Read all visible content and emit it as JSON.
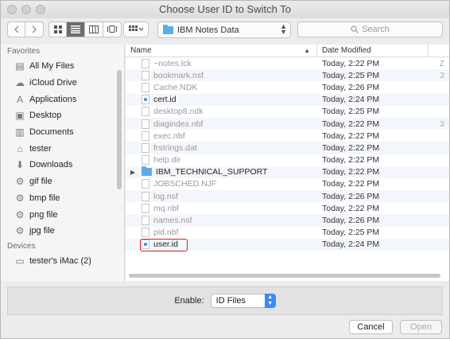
{
  "window": {
    "title": "Choose User ID to Switch To"
  },
  "toolbar": {
    "location": "IBM Notes Data",
    "search_placeholder": "Search",
    "views": [
      "icon-view",
      "list-view",
      "column-view",
      "coverflow-view"
    ],
    "active_view": "list-view"
  },
  "sidebar": {
    "favorites_heading": "Favorites",
    "favorites": [
      {
        "label": "All My Files",
        "icon": "all-files-icon"
      },
      {
        "label": "iCloud Drive",
        "icon": "cloud-icon"
      },
      {
        "label": "Applications",
        "icon": "applications-icon"
      },
      {
        "label": "Desktop",
        "icon": "desktop-icon"
      },
      {
        "label": "Documents",
        "icon": "documents-icon"
      },
      {
        "label": "tester",
        "icon": "home-icon"
      },
      {
        "label": "Downloads",
        "icon": "downloads-icon"
      },
      {
        "label": "gif file",
        "icon": "gear-icon"
      },
      {
        "label": "bmp file",
        "icon": "gear-icon"
      },
      {
        "label": "png file",
        "icon": "gear-icon"
      },
      {
        "label": "jpg file",
        "icon": "gear-icon"
      }
    ],
    "devices_heading": "Devices",
    "devices": [
      {
        "label": "tester's iMac (2)",
        "icon": "imac-icon"
      }
    ]
  },
  "columns": {
    "name": "Name",
    "date": "Date Modified"
  },
  "files": [
    {
      "name": "~notes.lck",
      "date": "Today, 2:22 PM",
      "extra": "Z",
      "enabled": false,
      "kind": "doc"
    },
    {
      "name": "bookmark.nsf",
      "date": "Today, 2:25 PM",
      "extra": "3",
      "enabled": false,
      "kind": "doc"
    },
    {
      "name": "Cache.NDK",
      "date": "Today, 2:26 PM",
      "extra": "",
      "enabled": false,
      "kind": "doc"
    },
    {
      "name": "cert.id",
      "date": "Today, 2:24 PM",
      "extra": "",
      "enabled": true,
      "kind": "id"
    },
    {
      "name": "desktop8.ndk",
      "date": "Today, 2:25 PM",
      "extra": "",
      "enabled": false,
      "kind": "doc"
    },
    {
      "name": "diagindex.nbf",
      "date": "Today, 2:22 PM",
      "extra": "3",
      "enabled": false,
      "kind": "doc"
    },
    {
      "name": "exec.nbf",
      "date": "Today, 2:22 PM",
      "extra": "",
      "enabled": false,
      "kind": "doc"
    },
    {
      "name": "frstrings.dat",
      "date": "Today, 2:22 PM",
      "extra": "",
      "enabled": false,
      "kind": "doc"
    },
    {
      "name": "help.dir",
      "date": "Today, 2:22 PM",
      "extra": "",
      "enabled": false,
      "kind": "doc"
    },
    {
      "name": "IBM_TECHNICAL_SUPPORT",
      "date": "Today, 2:22 PM",
      "extra": "",
      "enabled": true,
      "kind": "folder"
    },
    {
      "name": "JOBSCHED.NJF",
      "date": "Today, 2:22 PM",
      "extra": "",
      "enabled": false,
      "kind": "doc"
    },
    {
      "name": "log.nsf",
      "date": "Today, 2:26 PM",
      "extra": "",
      "enabled": false,
      "kind": "doc"
    },
    {
      "name": "mq.nbf",
      "date": "Today, 2:22 PM",
      "extra": "",
      "enabled": false,
      "kind": "doc"
    },
    {
      "name": "names.nsf",
      "date": "Today, 2:26 PM",
      "extra": "",
      "enabled": false,
      "kind": "doc"
    },
    {
      "name": "pid.nbf",
      "date": "Today, 2:25 PM",
      "extra": "",
      "enabled": false,
      "kind": "doc"
    },
    {
      "name": "user.id",
      "date": "Today, 2:24 PM",
      "extra": "",
      "enabled": true,
      "kind": "id",
      "highlighted": true
    }
  ],
  "footer": {
    "enable_label": "Enable:",
    "enable_value": "ID Files",
    "cancel_label": "Cancel",
    "open_label": "Open"
  },
  "colors": {
    "highlight": "#c8272d",
    "accent": "#3d8bf2",
    "folder": "#5aaee8"
  }
}
